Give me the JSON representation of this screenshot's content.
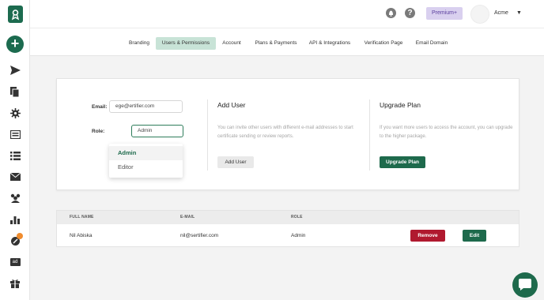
{
  "topbar": {
    "notification_icon": "bell-icon",
    "help_glyph": "?",
    "premium_label": "Premium+",
    "account_name": "Acme",
    "caret": "▼"
  },
  "sidebar": {
    "add_label": "+",
    "items": [
      "send-icon",
      "documents-icon",
      "settings-gear-icon",
      "template-icon",
      "list-icon",
      "mail-icon",
      "users-icon",
      "analytics-icon",
      "integrations-icon",
      "ad-icon",
      "gift-icon"
    ],
    "ad_label": "ad"
  },
  "tabs": [
    {
      "label": "Branding"
    },
    {
      "label": "Users & Permissions"
    },
    {
      "label": "Account"
    },
    {
      "label": "Plans & Payments"
    },
    {
      "label": "API & Integrations"
    },
    {
      "label": "Verification Page"
    },
    {
      "label": "Email Domain"
    }
  ],
  "active_tab": "Users & Permissions",
  "form": {
    "email_label": "Email:",
    "email_value": "ege@ertifier.com",
    "role_label": "Role:",
    "role_value": "Admin",
    "role_options": [
      "Admin",
      "Editor"
    ]
  },
  "add_user": {
    "title": "Add User",
    "description": "You can invite other users with different e-mail addresses to start certificate sending or review reports.",
    "button": "Add User"
  },
  "upgrade": {
    "title": "Upgrade Plan",
    "description": "If you want more users to access the account, you can upgrade to the higher package.",
    "button": "Upgrade Plan"
  },
  "table": {
    "columns": [
      "FULL NAME",
      "E-MAIL",
      "ROLE"
    ],
    "rows": [
      {
        "name": "Nil Abiska",
        "email": "nil@sertifier.com",
        "role": "Admin"
      }
    ],
    "remove_label": "Remove",
    "edit_label": "Edit"
  },
  "colors": {
    "brand_green": "#1e6a4c",
    "active_tab_bg": "#c8e3d7",
    "danger_red": "#b0192f",
    "premium_bg": "#d9d0ef"
  }
}
